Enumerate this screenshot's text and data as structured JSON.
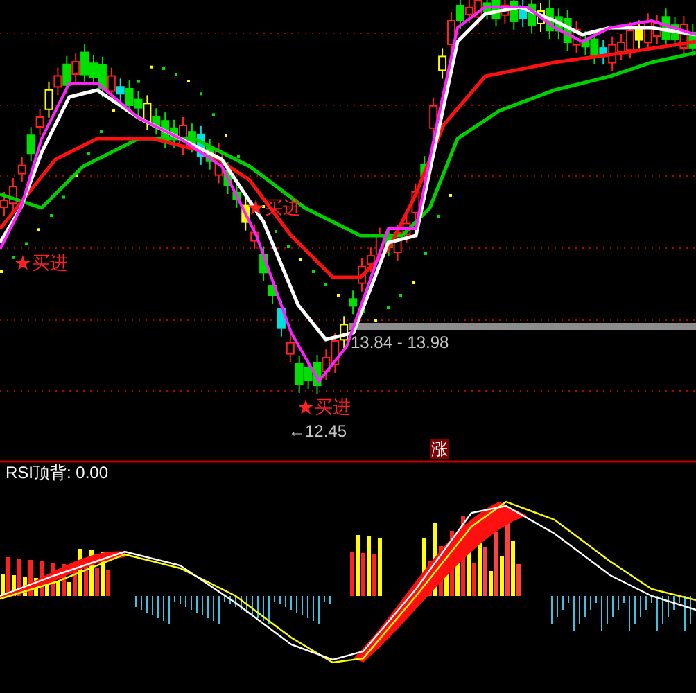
{
  "signals": [
    {
      "text": "★买进"
    },
    {
      "text": "★买进"
    },
    {
      "text": "★买进"
    }
  ],
  "price_range": "13.84 - 13.98",
  "low_price": "←12.45",
  "badge": "涨",
  "indicator": {
    "label": "RSI顶背: 0.00"
  }
}
